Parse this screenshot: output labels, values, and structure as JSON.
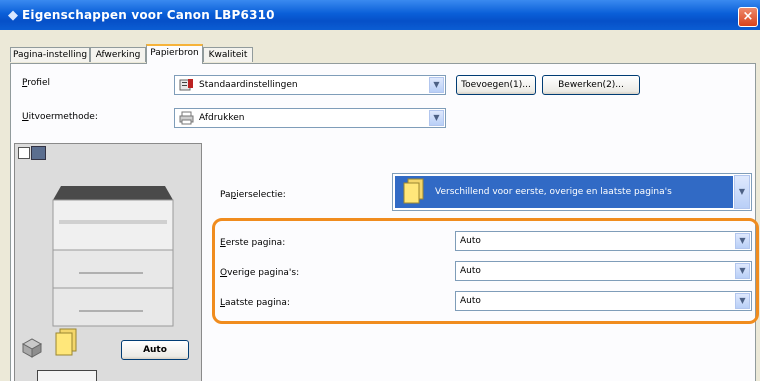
{
  "window": {
    "title": "Eigenschappen voor Canon LBP6310",
    "close_glyph": "×"
  },
  "tabs": [
    {
      "label": "Pagina-instelling"
    },
    {
      "label": "Afwerking"
    },
    {
      "label": "Papierbron"
    },
    {
      "label": "Kwaliteit"
    }
  ],
  "active_tab": "Papierbron",
  "profile": {
    "label_first": "P",
    "label_rest": "rofiel",
    "value": "Standaardinstellingen",
    "add_button": "Toevoegen(1)...",
    "edit_button": "Bewerken(2)..."
  },
  "output_method": {
    "label_first": "U",
    "label_rest": "itvoermethode:",
    "value": "Afdrukken"
  },
  "paper_selection": {
    "label_pre": "Pa",
    "label_u": "p",
    "label_post": "ierselectie:",
    "value": "Verschillend voor eerste, overige en laatste pagina's"
  },
  "first_page": {
    "label_first": "E",
    "label_rest": "erste pagina:",
    "value": "Auto"
  },
  "other_pages": {
    "label_first": "O",
    "label_rest": "verige pagina's:",
    "value": "Auto"
  },
  "last_page": {
    "label_first": "L",
    "label_rest": "aatste pagina:",
    "value": "Auto"
  },
  "preview": {
    "auto_button": "Auto"
  },
  "icons": {
    "window": "printer-icon",
    "profile": "profile-icon",
    "output": "printer-output-icon",
    "paper": "paper-stack-icon"
  },
  "colors": {
    "title_bar": "#0a5fd8",
    "highlight": "#f08c1e",
    "selection": "#316ac5"
  }
}
